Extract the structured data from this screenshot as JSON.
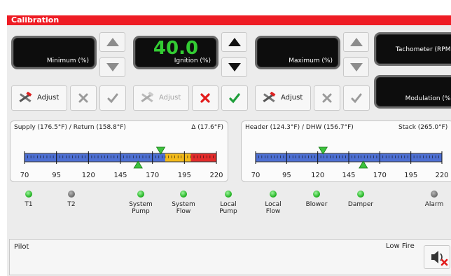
{
  "title": "Calibration",
  "displays": {
    "minimum": {
      "label": "Minimum (%)",
      "value": ""
    },
    "ignition": {
      "label": "Ignition (%)",
      "value": "40.0"
    },
    "maximum": {
      "label": "Maximum (%)",
      "value": ""
    },
    "tachometer": {
      "label": "Tachometer (RPM)",
      "value": ""
    },
    "modulation": {
      "label": "Modulation (%)",
      "value": ""
    }
  },
  "buttons": {
    "adjust": "Adjust"
  },
  "left_gauge": {
    "header_left": "Supply (176.5°F) / Return (158.8°F)",
    "header_right": "Δ (17.6°F)",
    "ticks": [
      "70",
      "95",
      "120",
      "145",
      "170",
      "195",
      "220"
    ],
    "range": [
      70,
      220
    ],
    "supply": 176.5,
    "return": 158.8,
    "zones": [
      {
        "from": 70,
        "to": 180,
        "color": "#4d6fd2"
      },
      {
        "from": 180,
        "to": 200,
        "color": "#f2b91a"
      },
      {
        "from": 200,
        "to": 220,
        "color": "#e22b2b"
      }
    ]
  },
  "right_gauge": {
    "header_left": "Header (124.3°F) / DHW (156.7°F)",
    "header_right": "Stack (265.0°F)",
    "ticks": [
      "70",
      "95",
      "120",
      "145",
      "170",
      "195",
      "220"
    ],
    "range": [
      70,
      220
    ],
    "header": 124.3,
    "dhw": 156.7,
    "zones": [
      {
        "from": 70,
        "to": 220,
        "color": "#4d6fd2"
      }
    ]
  },
  "indicators": [
    {
      "label": "T1",
      "on": true
    },
    {
      "label": "T2",
      "on": false
    },
    {
      "label": "System Pump",
      "on": true
    },
    {
      "label": "System Flow",
      "on": true
    },
    {
      "label": "Local Pump",
      "on": true
    },
    {
      "label": "Local Flow",
      "on": true
    },
    {
      "label": "Blower",
      "on": true
    },
    {
      "label": "Damper",
      "on": true
    },
    {
      "label": "Alarm",
      "on": false
    }
  ],
  "status": {
    "left": "Pilot",
    "right": "Low Fire"
  }
}
